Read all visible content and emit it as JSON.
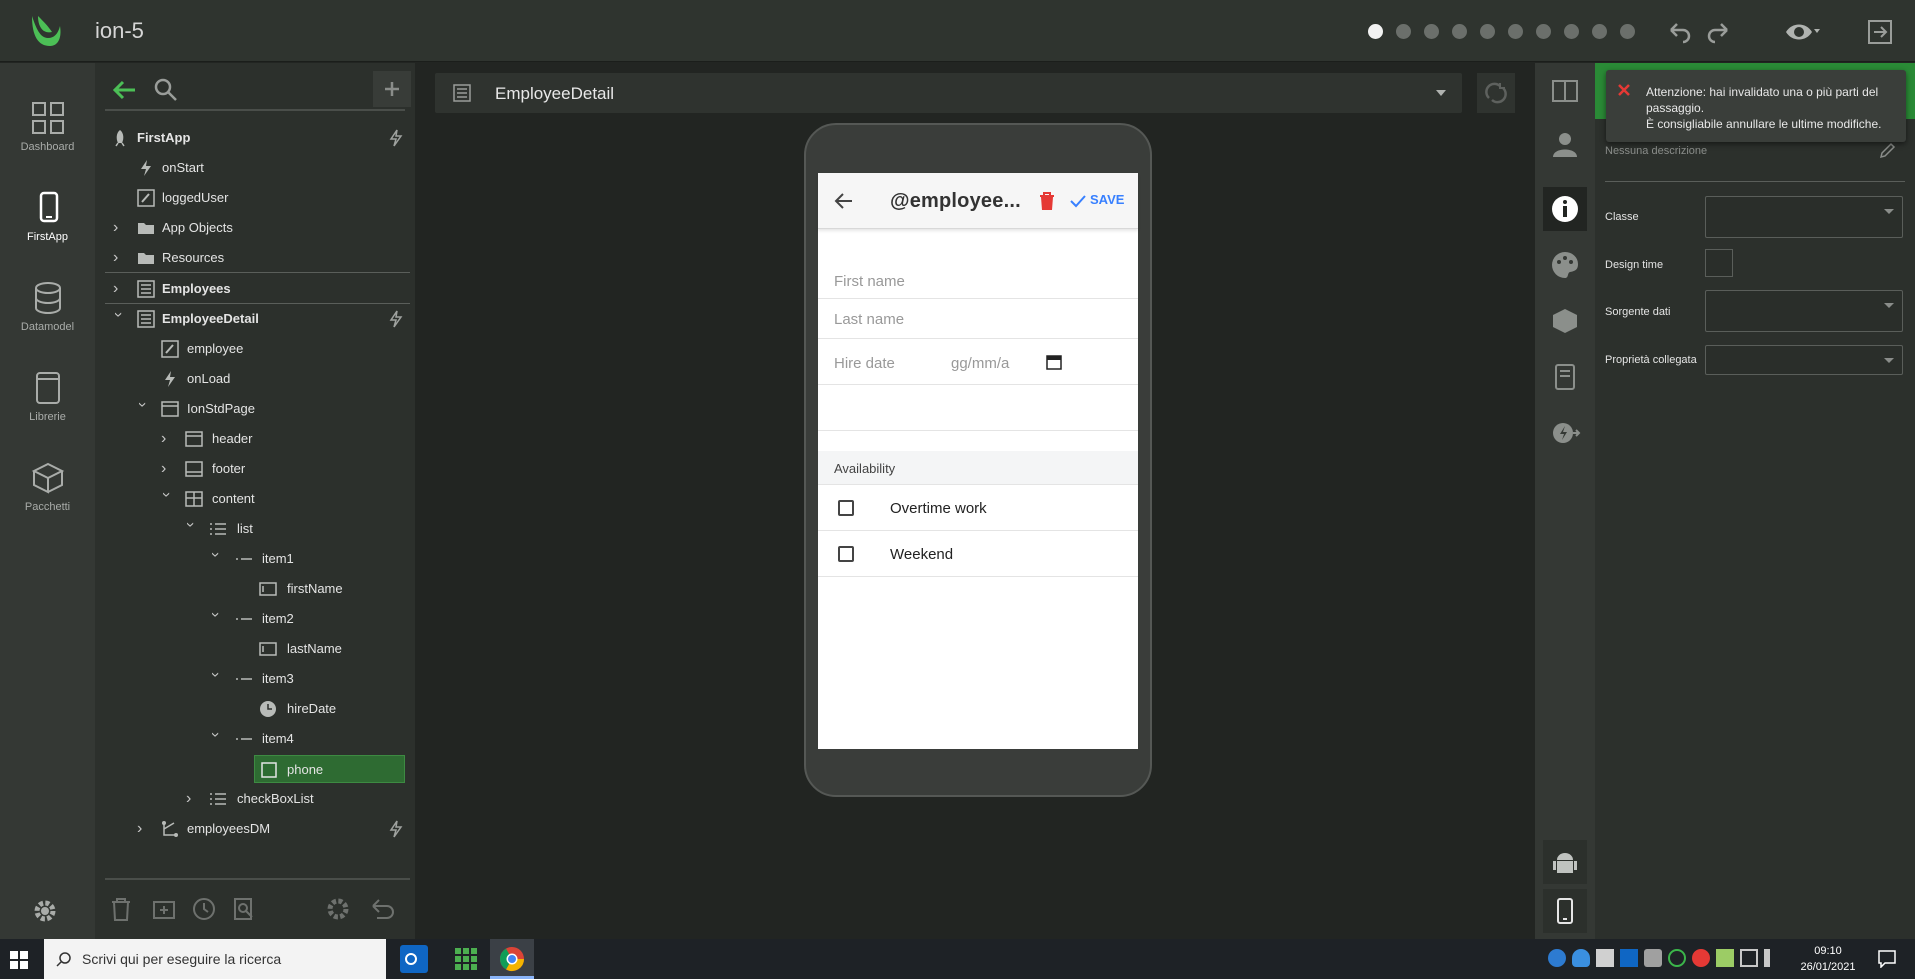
{
  "app": {
    "title": "ion-5",
    "progress_steps": 10,
    "progress_current": 1
  },
  "leftnav": [
    {
      "label": "Dashboard",
      "icon": "dashboard-icon"
    },
    {
      "label": "FirstApp",
      "icon": "phone-icon"
    },
    {
      "label": "Datamodel",
      "icon": "database-icon"
    },
    {
      "label": "Librerie",
      "icon": "book-icon"
    },
    {
      "label": "Pacchetti",
      "icon": "package-icon"
    }
  ],
  "tree": {
    "items": [
      {
        "label": "FirstApp",
        "bold": true
      },
      {
        "label": "onStart"
      },
      {
        "label": "loggedUser"
      },
      {
        "label": "App Objects"
      },
      {
        "label": "Resources"
      },
      {
        "label": "Employees",
        "bold": true
      },
      {
        "label": "EmployeeDetail",
        "bold": true
      },
      {
        "label": "employee"
      },
      {
        "label": "onLoad"
      },
      {
        "label": "IonStdPage"
      },
      {
        "label": "header"
      },
      {
        "label": "footer"
      },
      {
        "label": "content"
      },
      {
        "label": "list"
      },
      {
        "label": "item1"
      },
      {
        "label": "firstName"
      },
      {
        "label": "item2"
      },
      {
        "label": "lastName"
      },
      {
        "label": "item3"
      },
      {
        "label": "hireDate"
      },
      {
        "label": "item4"
      },
      {
        "label": "phone",
        "selected": true
      },
      {
        "label": "checkBoxList"
      },
      {
        "label": "employeesDM"
      }
    ]
  },
  "center": {
    "page_name": "EmployeeDetail",
    "preview": {
      "title": "@employee...",
      "save_label": "SAVE",
      "first_name": "First name",
      "last_name": "Last name",
      "hire_date": "Hire date",
      "hire_date_placeholder": "gg/mm/a",
      "section_header": "Availability",
      "checkbox_1": "Overtime work",
      "checkbox_2": "Weekend"
    }
  },
  "props": {
    "description": "Nessuna descrizione",
    "classe_label": "Classe",
    "design_time_label": "Design time",
    "sorgente_label": "Sorgente dati",
    "proprieta_label": "Proprietà collegata"
  },
  "toast": {
    "line1": "Attenzione: hai invalidato una o più parti del passaggio.",
    "line2": "È consigliabile annullare le ultime modifiche."
  },
  "taskbar": {
    "search_placeholder": "Scrivi qui per eseguire la ricerca",
    "time": "09:10",
    "date": "26/01/2021"
  },
  "colors": {
    "accent": "#3fae49",
    "selected": "#2e6b32",
    "danger": "#e53935",
    "primary": "#3880ff"
  }
}
